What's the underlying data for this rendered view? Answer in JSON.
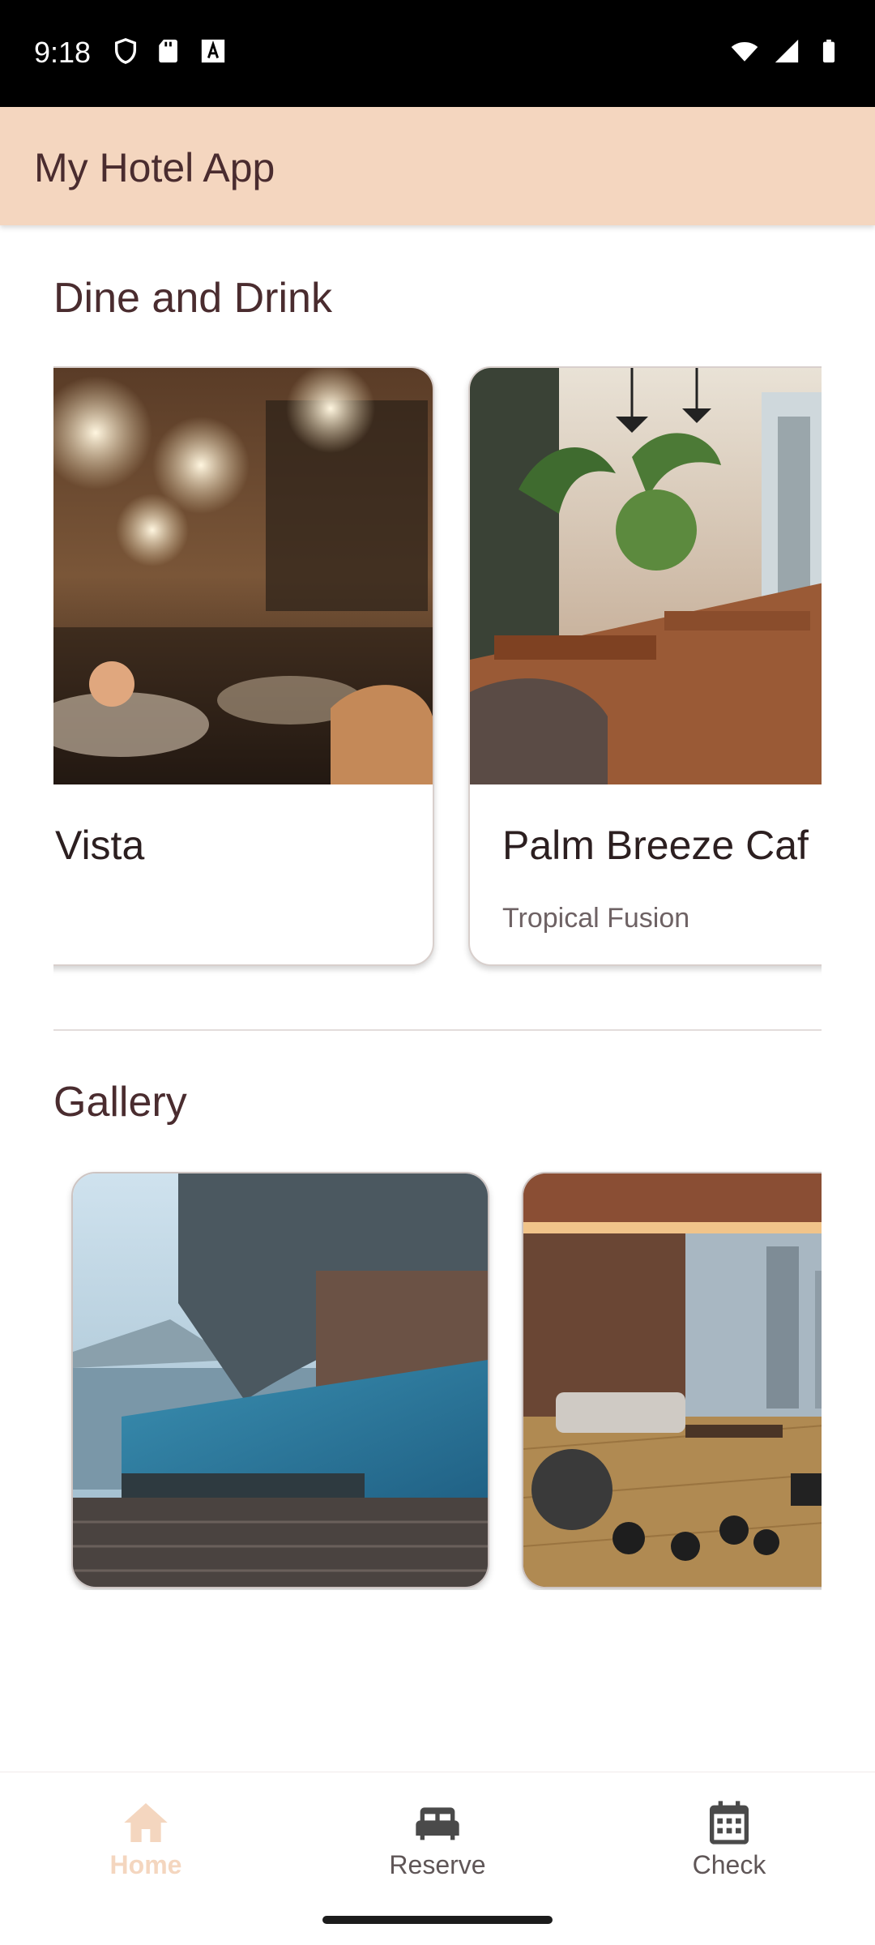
{
  "status_bar": {
    "time": "9:18",
    "left_icons": [
      "shield-icon",
      "sd-card-icon",
      "text-a-icon"
    ],
    "right_icons": [
      "wifi-icon",
      "signal-icon",
      "battery-icon"
    ]
  },
  "app_bar": {
    "title": "My Hotel App",
    "background": "#f4d6bf"
  },
  "dine": {
    "section_title": "Dine and Drink",
    "cards": [
      {
        "name": "Vista",
        "subtitle": ""
      },
      {
        "name": "Palm Breeze Caf",
        "subtitle": "Tropical Fusion"
      }
    ]
  },
  "gallery": {
    "section_title": "Gallery",
    "items": [
      "infinity-pool-photo",
      "gym-lounge-photo"
    ]
  },
  "bottom_nav": {
    "items": [
      {
        "label": "Home",
        "icon": "home-icon",
        "active": true
      },
      {
        "label": "Reserve",
        "icon": "bed-icon",
        "active": false
      },
      {
        "label": "Check",
        "icon": "calendar-icon",
        "active": false
      }
    ],
    "active_color": "#f4d6bf"
  }
}
